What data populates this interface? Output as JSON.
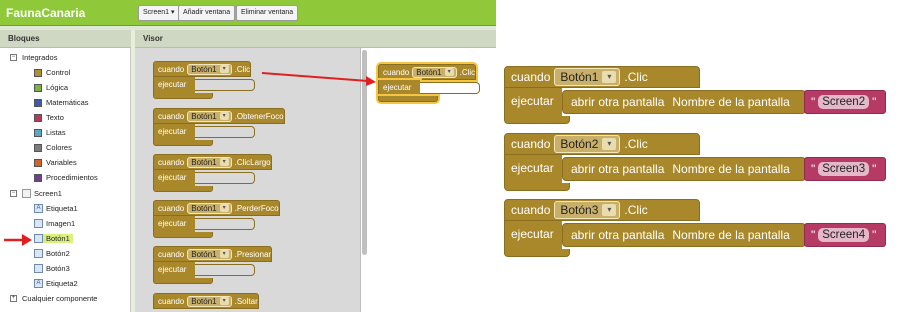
{
  "app": {
    "title": "FaunaCanaria",
    "screen_dropdown": "Screen1 ▾",
    "add_screen": "Añadir ventana",
    "delete_screen": "Eliminar ventana"
  },
  "panels": {
    "blocks_title": "Bloques",
    "viewer_title": "Visor"
  },
  "tree": {
    "builtin": "Integrados",
    "builtin_items": [
      {
        "label": "Control",
        "color": "#b28e2f"
      },
      {
        "label": "Lógica",
        "color": "#7bb140"
      },
      {
        "label": "Matemáticas",
        "color": "#3f5ba8"
      },
      {
        "label": "Texto",
        "color": "#b6385d"
      },
      {
        "label": "Listas",
        "color": "#5aa7c9"
      },
      {
        "label": "Colores",
        "color": "#7c7c7c"
      },
      {
        "label": "Variables",
        "color": "#d0642c"
      },
      {
        "label": "Procedimientos",
        "color": "#6d3f8c"
      }
    ],
    "screen": "Screen1",
    "components": [
      "Etiqueta1",
      "Imagen1",
      "Botón1",
      "Botón2",
      "Botón3",
      "Etiqueta2"
    ],
    "any_component": "Cualquier componente"
  },
  "drawer_blocks": [
    {
      "when": "cuando",
      "component": "Botón1",
      "event": ".Clic",
      "do": "ejecutar"
    },
    {
      "when": "cuando",
      "component": "Botón1",
      "event": ".ObtenerFoco",
      "do": "ejecutar"
    },
    {
      "when": "cuando",
      "component": "Botón1",
      "event": ".ClicLargo",
      "do": "ejecutar"
    },
    {
      "when": "cuando",
      "component": "Botón1",
      "event": ".PerderFoco",
      "do": "ejecutar"
    },
    {
      "when": "cuando",
      "component": "Botón1",
      "event": ".Presionar",
      "do": "ejecutar"
    },
    {
      "when": "cuando",
      "component": "Botón1",
      "event": ".Soltar",
      "do": ""
    }
  ],
  "dragged_block": {
    "when": "cuando",
    "component": "Botón1",
    "event": ".Clic",
    "do": "ejecutar"
  },
  "code_blocks": [
    {
      "when": "cuando",
      "component": "Botón1",
      "event": ".Clic",
      "do": "ejecutar",
      "call": "abrir otra pantalla",
      "param": "Nombre de la pantalla",
      "quote_open": "\"",
      "value": "Screen2",
      "quote_close": "\""
    },
    {
      "when": "cuando",
      "component": "Botón2",
      "event": ".Clic",
      "do": "ejecutar",
      "call": "abrir otra pantalla",
      "param": "Nombre de la pantalla",
      "quote_open": "\"",
      "value": "Screen3",
      "quote_close": "\""
    },
    {
      "when": "cuando",
      "component": "Botón3",
      "event": ".Clic",
      "do": "ejecutar",
      "call": "abrir otra pantalla",
      "param": "Nombre de la pantalla",
      "quote_open": "\"",
      "value": "Screen4",
      "quote_close": "\""
    }
  ],
  "colors": {
    "header_green": "#8fc93a",
    "control_block": "#a9882c",
    "text_block": "#b53a64",
    "arrow": "#e02020",
    "selection": "#d9f07f"
  }
}
